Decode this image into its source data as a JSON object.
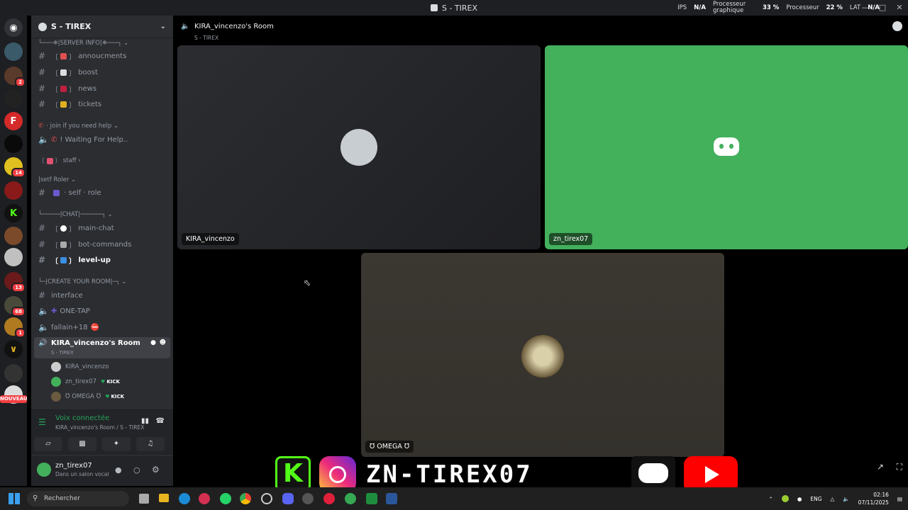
{
  "window": {
    "title": "S - TIREX"
  },
  "servers": {
    "badges": [
      "2",
      "14",
      "13",
      "68",
      "1"
    ],
    "nouveau": "NOUVEAU"
  },
  "sidebar": {
    "server_name": "S - TIREX",
    "channels": [
      {
        "label": "└───❄|SERVER INFO|❄───┐ ⌄",
        "kind": "category"
      },
      {
        "label": "annoucments",
        "kind": "text"
      },
      {
        "label": "boost",
        "kind": "text"
      },
      {
        "label": "news",
        "kind": "text"
      },
      {
        "label": "tickets",
        "kind": "text"
      },
      {
        "label": "· join if you need help ⌄",
        "kind": "category"
      },
      {
        "label": "! Waiting For Help..",
        "kind": "voice"
      },
      {
        "label": "staff ›",
        "kind": "category"
      },
      {
        "label": "|setf Roler ⌄",
        "kind": "category"
      },
      {
        "label": "· self · role",
        "kind": "text"
      },
      {
        "label": "└─────|CHAT|──────┐ ⌄",
        "kind": "category"
      },
      {
        "label": "main-chat",
        "kind": "text"
      },
      {
        "label": "bot-commands",
        "kind": "text"
      },
      {
        "label": "level-up",
        "kind": "text"
      },
      {
        "label": "└─|CREATE YOUR ROOM|─┐ ⌄",
        "kind": "category"
      },
      {
        "label": "interface",
        "kind": "text"
      },
      {
        "label": "ONE-TAP",
        "kind": "voice"
      },
      {
        "label": "fallain+18",
        "kind": "voice"
      }
    ],
    "room": {
      "name": "KIRA_vincenzo's Room",
      "sub": "S - TIREX"
    },
    "members": [
      {
        "name": "KIRA_vincenzo",
        "kick": ""
      },
      {
        "name": "zn_tirex07",
        "kick": "KICK"
      },
      {
        "name": "Ʊ OMEGA Ʊ",
        "kick": "KICK"
      }
    ]
  },
  "voice": {
    "title": "Voix connectée",
    "sub": "KIRA_vincenzo's Room / S - TIREX"
  },
  "user": {
    "name": "zn_tirex07",
    "status": "Dans un salon vocal"
  },
  "main": {
    "room_title": "KIRA_vincenzo's Room",
    "room_sub": "S - TIREX",
    "stats": {
      "ips_label": "IPS",
      "ips": "N/A",
      "gpu_label": "Processeur graphique",
      "gpu": "33 %",
      "cpu_label": "Processeur",
      "cpu": "22 %",
      "lat_label": "LAT",
      "lat": "N/A"
    },
    "tiles": [
      {
        "label": "KIRA_vincenzo",
        "color": "#2b2d31"
      },
      {
        "label": "zn_tirex07",
        "color": "#43b05c"
      },
      {
        "label": "Ʊ OMEGA Ʊ",
        "color": "#3b3731"
      }
    ]
  },
  "taskbar": {
    "search": "Rechercher",
    "lang": "ENG",
    "time": "02:16",
    "date": "07/11/2025"
  },
  "banner": {
    "text": "ZN-TIREX07"
  }
}
